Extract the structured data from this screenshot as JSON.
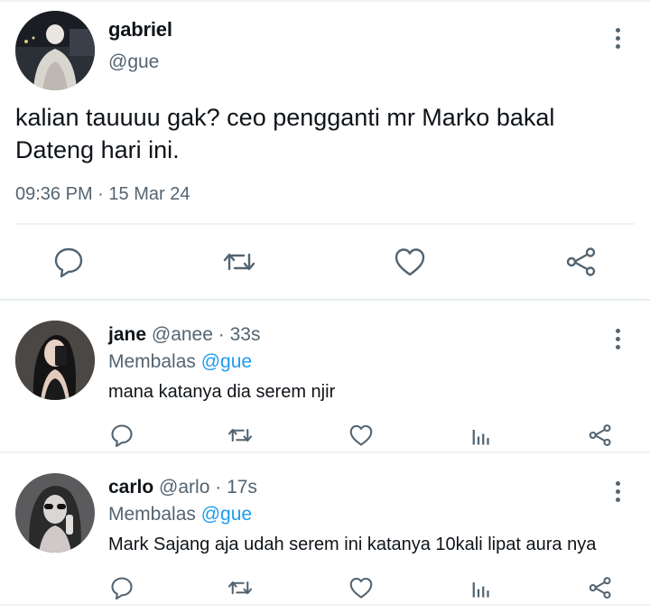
{
  "main_tweet": {
    "display_name": "gabriel",
    "handle": "@gue",
    "text": "kalian tauuuu gak? ceo pengganti mr Marko bakal Dateng hari ini.",
    "time": "09:36 PM",
    "separator": "·",
    "date": "15 Mar 24",
    "actions": [
      "reply-icon",
      "retweet-icon",
      "like-icon",
      "share-icon"
    ]
  },
  "replies": [
    {
      "display_name": "jane",
      "handle": "@anee",
      "separator": "·",
      "time_ago": "33s",
      "replying_label": "Membalas",
      "replying_to": "@gue",
      "text": "mana katanya dia serem njir"
    },
    {
      "display_name": "carlo",
      "handle": "@arlo",
      "separator": "·",
      "time_ago": "17s",
      "replying_label": "Membalas",
      "replying_to": "@gue",
      "text": "Mark Sajang aja udah serem ini katanya 10kali lipat aura nya"
    }
  ],
  "colors": {
    "text": "#0f1419",
    "secondary": "#536471",
    "accent": "#1d9bf0",
    "divider": "#eff3f4"
  }
}
